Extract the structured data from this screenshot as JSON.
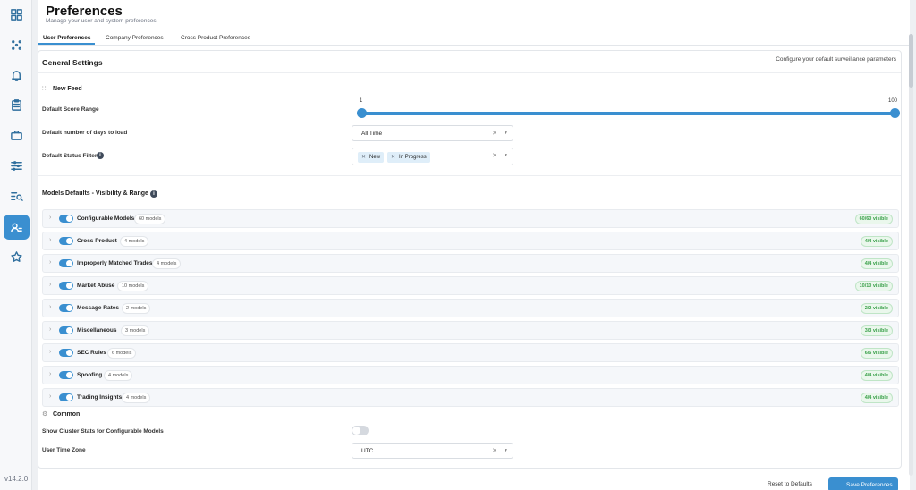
{
  "sidebar": {
    "icons": [
      "dashboard-icon",
      "network-icon",
      "bell-icon",
      "clipboard-icon",
      "briefcase-icon",
      "sliders-icon",
      "search-list-icon",
      "user-settings-icon",
      "star-icon"
    ],
    "version": "v14.2.0"
  },
  "header": {
    "title": "Preferences",
    "subtitle": "Manage your user and system preferences"
  },
  "tabs": [
    {
      "label": "User Preferences",
      "active": true
    },
    {
      "label": "Company Preferences",
      "active": false
    },
    {
      "label": "Cross Product Preferences",
      "active": false
    }
  ],
  "general": {
    "title": "General Settings",
    "right_text": "Configure your default surveillance parameters",
    "new_feed": "New Feed",
    "score_range_label": "Default Score Range",
    "score_min": "1",
    "score_max": "100",
    "days_label": "Default number of days to load",
    "days_value": "All Time",
    "status_label": "Default Status Filter",
    "status_chips": [
      "New",
      "In Progress"
    ]
  },
  "models": {
    "title": "Models Defaults - Visibility & Range",
    "rows": [
      {
        "name": "Configurable Models",
        "count": "60 models",
        "visible": "60/60 visible"
      },
      {
        "name": "Cross Product",
        "count": "4 models",
        "visible": "4/4 visible"
      },
      {
        "name": "Improperly Matched Trades",
        "count": "4 models",
        "visible": "4/4 visible"
      },
      {
        "name": "Market Abuse",
        "count": "10 models",
        "visible": "10/10 visible"
      },
      {
        "name": "Message Rates",
        "count": "2 models",
        "visible": "2/2 visible"
      },
      {
        "name": "Miscellaneous",
        "count": "3 models",
        "visible": "3/3 visible"
      },
      {
        "name": "SEC Rules",
        "count": "6 models",
        "visible": "6/6 visible"
      },
      {
        "name": "Spoofing",
        "count": "4 models",
        "visible": "4/4 visible"
      },
      {
        "name": "Trading Insights",
        "count": "4 models",
        "visible": "4/4 visible"
      }
    ]
  },
  "common": {
    "title": "Common",
    "cluster_label": "Show Cluster Stats for Configurable Models",
    "cluster_enabled": false,
    "tz_label": "User Time Zone",
    "tz_value": "UTC"
  },
  "footer": {
    "reset": "Reset to Defaults",
    "save": "Save Preferences"
  },
  "colors": {
    "accent": "#3a8fd0",
    "visible_green": "#3aa04a"
  }
}
